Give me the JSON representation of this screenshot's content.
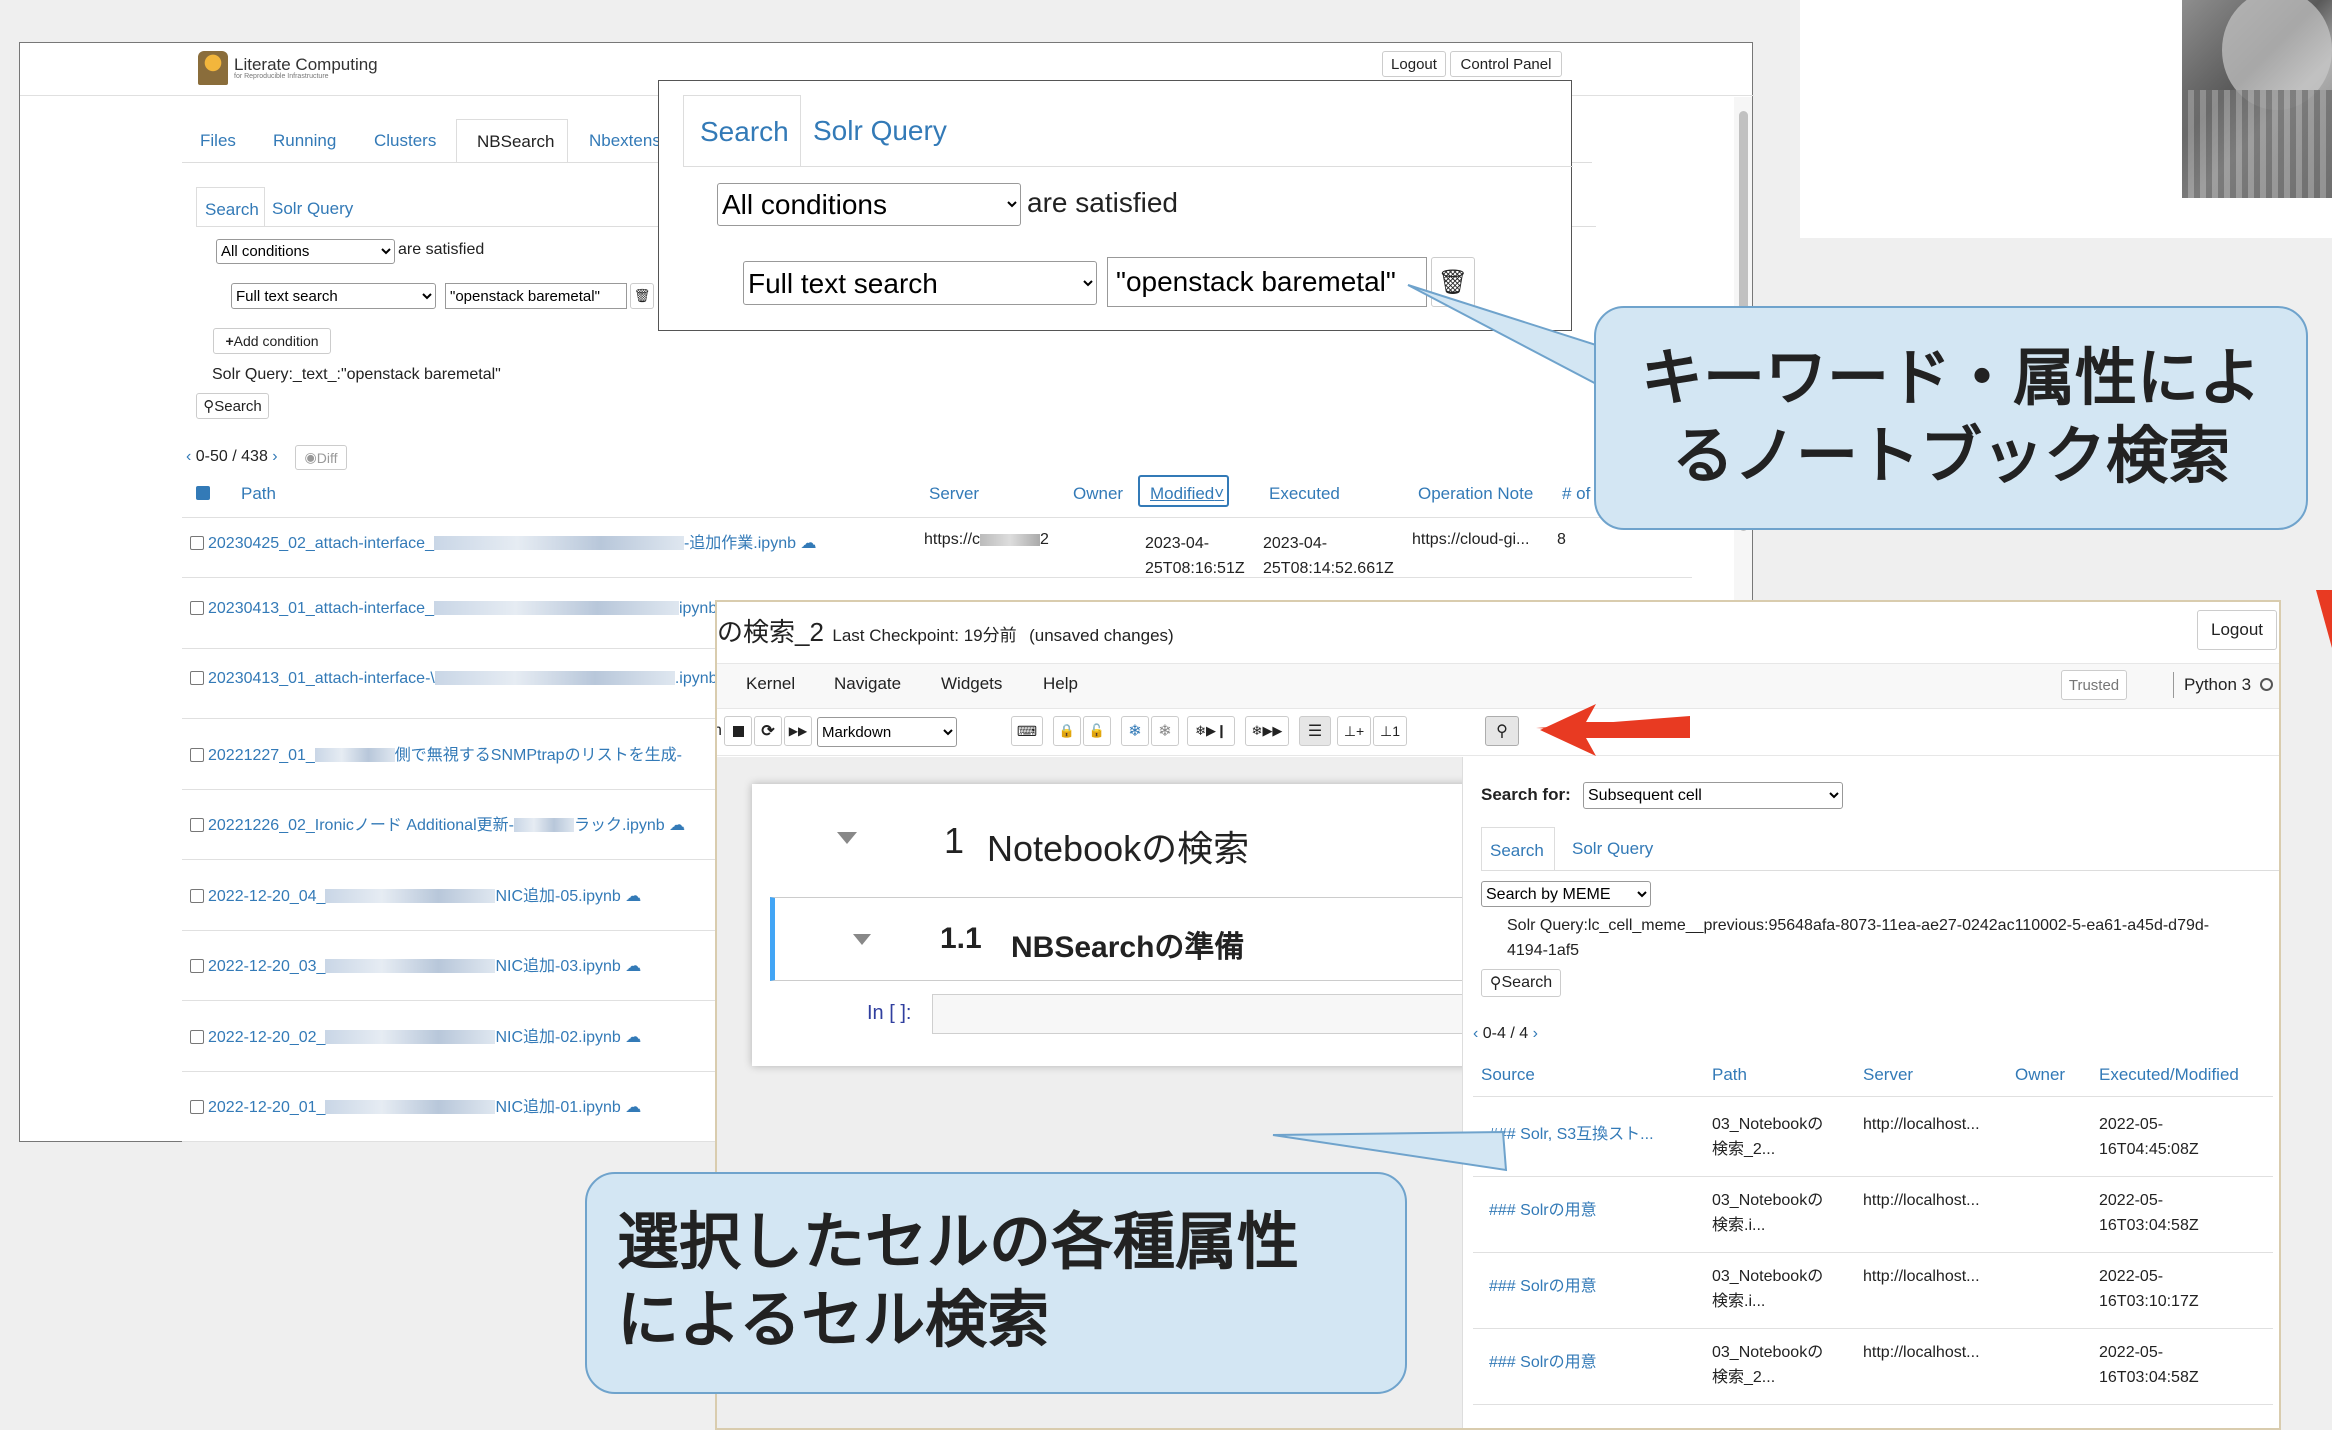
{
  "jupyter": {
    "logo_text": "Literate Computing",
    "logo_sub": "for Reproducible Infrastructure",
    "logout": "Logout",
    "control_panel": "Control Panel",
    "tabs": [
      "Files",
      "Running",
      "Clusters",
      "NBSearch",
      "Nbextensi"
    ],
    "search_tabs": [
      "Search",
      "Solr Query"
    ],
    "cond_select": "All conditions",
    "cond_suffix": "are satisfied",
    "field_select": "Full text search",
    "field_value": "\"openstack baremetal\"",
    "add_condition": "Add condition",
    "solr_query": "Solr Query:_text_:\"openstack baremetal\"",
    "search_btn": "Search",
    "pager": "0-50 / 438",
    "diff": "Diff",
    "columns": [
      "Path",
      "Server",
      "Owner",
      "Modified",
      "Executed",
      "Operation Note",
      "# of"
    ],
    "row1": {
      "server": "https://c",
      "server_end": "2",
      "modified": [
        "2023-04-",
        "25T08:16:51Z"
      ],
      "executed": [
        "2023-04-",
        "25T08:14:52.661Z"
      ],
      "note": "https://cloud-gi...",
      "count": "8"
    },
    "files": [
      {
        "prefix": "20230425_02_attach-interface_",
        "suffix": "-追加作業.ipynb"
      },
      {
        "prefix": "20230413_01_attach-interface_",
        "suffix": "ipynb"
      },
      {
        "prefix": "20230413_01_attach-interface-\\",
        "suffix": ".ipynb"
      },
      {
        "prefix": "20221227_01_",
        "suffix": "側で無視するSNMPtrapのリストを生成-"
      },
      {
        "prefix": "20221226_02_Ironicノード Additional更新-",
        "suffix": "ラック.ipynb"
      },
      {
        "prefix": "2022-12-20_04_",
        "suffix": "NIC追加-05.ipynb"
      },
      {
        "prefix": "2022-12-20_03_",
        "suffix": "NIC追加-03.ipynb"
      },
      {
        "prefix": "2022-12-20_02_",
        "suffix": "NIC追加-02.ipynb"
      },
      {
        "prefix": "2022-12-20_01_",
        "suffix": "NIC追加-01.ipynb"
      }
    ]
  },
  "zoom": {
    "tabs": [
      "Search",
      "Solr Query"
    ],
    "cond_select": "All conditions",
    "cond_suffix": "are satisfied",
    "field_select": "Full text search",
    "field_value": "\"openstack baremetal\""
  },
  "callout_top": [
    "キーワード・属性によ",
    "るノートブック検索"
  ],
  "callout_bottom": [
    "選択したセルの各種属性",
    "によるセル検索"
  ],
  "notebook": {
    "title": "の検索_2",
    "checkpoint": "Last Checkpoint: 19分前",
    "unsaved": "(unsaved changes)",
    "logout": "Logout",
    "menus": [
      "Kernel",
      "Navigate",
      "Widgets",
      "Help"
    ],
    "trusted": "Trusted",
    "kernel": "Python 3",
    "cell_type": "Markdown",
    "heading1_num": "1",
    "heading1": "Notebookの検索",
    "heading2_num": "1.1",
    "heading2": "NBSearchの準備",
    "prompt": "In [ ]:",
    "left_cut": "n"
  },
  "panel": {
    "search_for_label": "Search for:",
    "search_for_value": "Subsequent cell",
    "tabs": [
      "Search",
      "Solr Query"
    ],
    "meme_select": "Search by MEME",
    "query_line1": "Solr Query:lc_cell_meme__previous:95648afa-8073-11ea-ae27-0242ac110002-5-ea61-a45d-d79d-",
    "query_line2": "4194-1af5",
    "search_btn": "Search",
    "pager": "0-4 / 4",
    "columns": [
      "Source",
      "Path",
      "Server",
      "Owner",
      "Executed/Modified"
    ],
    "rows": [
      {
        "source": "### Solr, S3互換スト...",
        "path": [
          "03_Notebookの",
          "検索_2..."
        ],
        "server": "http://localhost...",
        "date": [
          "2022-05-",
          "16T04:45:08Z"
        ]
      },
      {
        "source": "### Solrの用意",
        "path": [
          "03_Notebookの",
          "検索.i..."
        ],
        "server": "http://localhost...",
        "date": [
          "2022-05-",
          "16T03:04:58Z"
        ]
      },
      {
        "source": "### Solrの用意",
        "path": [
          "03_Notebookの",
          "検索.i..."
        ],
        "server": "http://localhost...",
        "date": [
          "2022-05-",
          "16T03:10:17Z"
        ]
      },
      {
        "source": "### Solrの用意",
        "path": [
          "03_Notebookの",
          "検索_2..."
        ],
        "server": "http://localhost...",
        "date": [
          "2022-05-",
          "16T03:04:58Z"
        ]
      }
    ]
  },
  "colors": {
    "link": "#337ab7",
    "callout_bg": "#d3e6f3",
    "callout_border": "#6fa3cc",
    "arrow": "#e83a22",
    "selected_cell": "#42a5f5"
  },
  "icons": [
    "logo-icon",
    "trash-icon",
    "plus-icon",
    "search-icon",
    "eye-icon",
    "cloud-icon",
    "stop-icon",
    "restart-icon",
    "fast-forward-icon",
    "keyboard-icon",
    "lock-icon",
    "unlock-icon",
    "snowflake-icon",
    "list-icon",
    "pin-icon",
    "red-arrow-icon"
  ]
}
